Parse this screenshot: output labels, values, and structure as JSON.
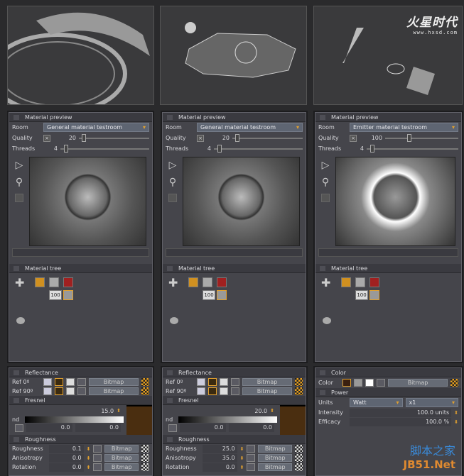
{
  "logo": {
    "text": "火星时代",
    "url": "www.hxsd.com"
  },
  "watermark": {
    "cn": "脚本之家",
    "en": "JB51.Net"
  },
  "columns": [
    {
      "preview": {
        "title": "Material preview",
        "room_label": "Room",
        "room": "General material testroom",
        "quality_label": "Quality",
        "quality": "20",
        "threads_label": "Threads",
        "threads": "4"
      },
      "tree": {
        "title": "Material tree",
        "weight": "100"
      }
    },
    {
      "preview": {
        "title": "Material preview",
        "room_label": "Room",
        "room": "General material testroom",
        "quality_label": "Quality",
        "quality": "20",
        "threads_label": "Threads",
        "threads": "4"
      },
      "tree": {
        "title": "Material tree",
        "weight": "100"
      }
    },
    {
      "preview": {
        "title": "Material preview",
        "room_label": "Room",
        "room": "Emitter material testroom",
        "quality_label": "Quality",
        "quality": "100",
        "threads_label": "Threads",
        "threads": "4"
      },
      "tree": {
        "title": "Material tree",
        "weight": "100"
      }
    }
  ],
  "reflect": [
    {
      "title": "Reflectance",
      "ref0": "Ref 0º",
      "ref90": "Ref 90º",
      "bitmap": "Bitmap",
      "fresnel": "Fresnel",
      "nd": "nd",
      "nd_value": "15.0",
      "low": "0.0",
      "high": "0.0",
      "rough_title": "Roughness",
      "rows": [
        {
          "label": "Roughness",
          "value": "0.1"
        },
        {
          "label": "Anisotropy",
          "value": "0.0"
        },
        {
          "label": "Rotation",
          "value": "0.0"
        }
      ]
    },
    {
      "title": "Reflectance",
      "ref0": "Ref 0º",
      "ref90": "Ref 90º",
      "bitmap": "Bitmap",
      "fresnel": "Fresnel",
      "nd": "nd",
      "nd_value": "20.0",
      "low": "0.0",
      "high": "0.0",
      "rough_title": "Roughness",
      "rows": [
        {
          "label": "Roughness",
          "value": "25.0"
        },
        {
          "label": "Anisotropy",
          "value": "35.0"
        },
        {
          "label": "Rotation",
          "value": "0.0"
        }
      ]
    }
  ],
  "emitter": {
    "color_title": "Color",
    "color_label": "Color",
    "bitmap": "Bitmap",
    "power_title": "Power",
    "units_label": "Units",
    "units": "Watt",
    "mult": "x1",
    "intensity_label": "Intensity",
    "intensity": "100.0 units",
    "efficacy_label": "Efficacy",
    "efficacy": "100.0 %"
  }
}
